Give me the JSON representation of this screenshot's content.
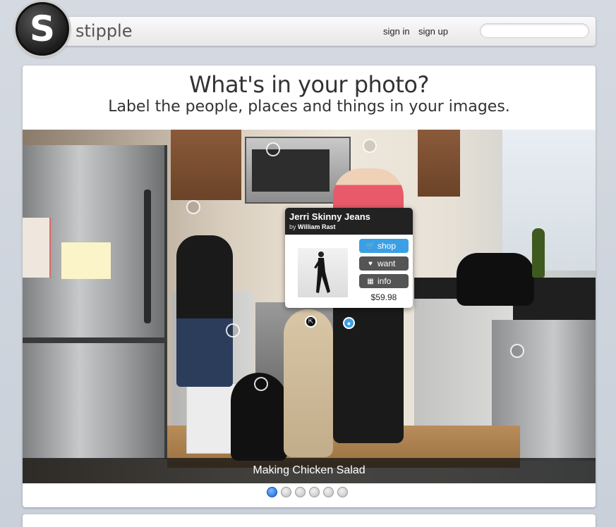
{
  "header": {
    "brand": "stipple",
    "logo_letter": "S",
    "sign_in": "sign in",
    "sign_up": "sign up",
    "search_placeholder": ""
  },
  "hero": {
    "headline": "What's in your photo?",
    "subheadline": "Label the people, places and things in your images."
  },
  "photo": {
    "caption": "Making Chicken Salad"
  },
  "product_popup": {
    "title": "Jerri Skinny Jeans",
    "by_prefix": "by",
    "brand": "William Rast",
    "shop_label": "shop",
    "want_label": "want",
    "info_label": "info",
    "price": "$59.98",
    "shop_color": "#3aa0e6",
    "dark_button_color": "#555555"
  },
  "pager": {
    "pages": 6,
    "active_index": 0
  }
}
